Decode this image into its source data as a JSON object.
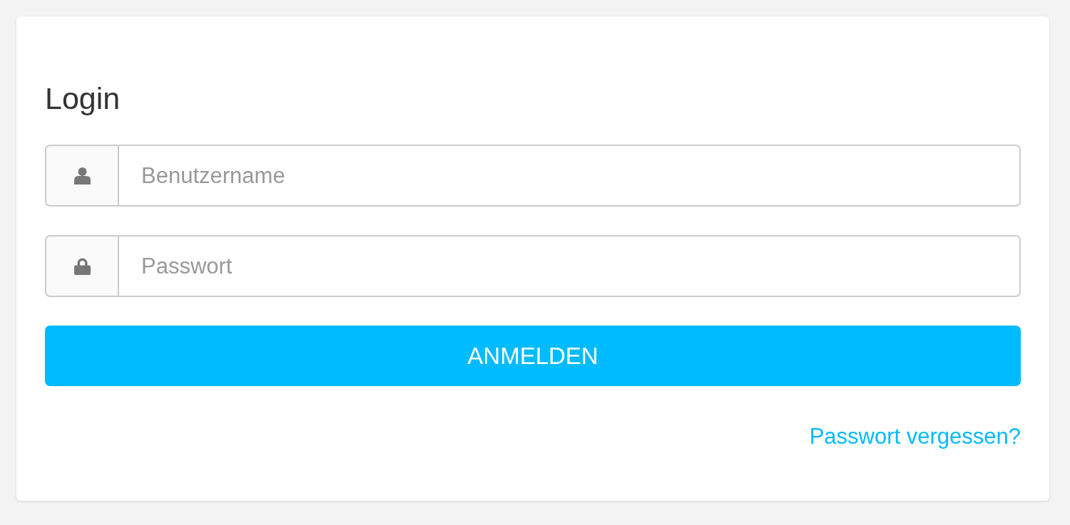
{
  "card": {
    "title": "Login",
    "fields": [
      {
        "kind": "username",
        "placeholder": "Benutzername"
      },
      {
        "kind": "password",
        "placeholder": "Passwort"
      }
    ],
    "submit_button": {
      "label": "ANMELDEN"
    },
    "forgot_password_link": {
      "text": "Passwort vergessen?"
    }
  }
}
